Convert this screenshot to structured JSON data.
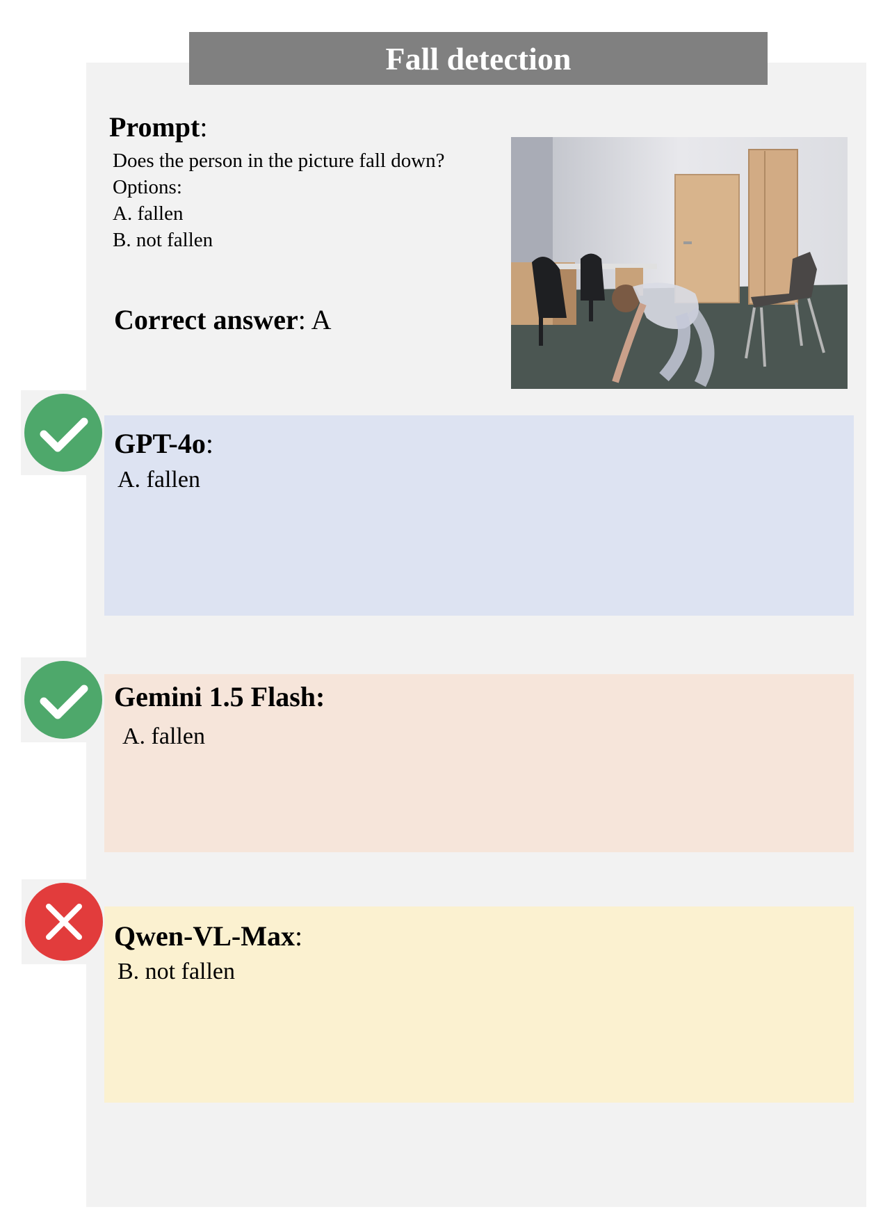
{
  "title": "Fall detection",
  "prompt": {
    "label": "Prompt",
    "colon": ":",
    "question": "Does the person in the picture fall down?",
    "options_label": "Options:",
    "options": [
      "A. fallen",
      "B. not fallen"
    ]
  },
  "correct_answer": {
    "label": "Correct answer",
    "value": ": A"
  },
  "models": [
    {
      "name": "GPT-4o",
      "suffix": ":",
      "answer": "A. fallen",
      "result": "check-icon",
      "color": "#dde3f2"
    },
    {
      "name": "Gemini 1.5 Flash:",
      "suffix": "",
      "answer": "A. fallen",
      "result": "check-icon",
      "color": "#f6e5da"
    },
    {
      "name": "Qwen-VL-Max",
      "suffix": ":",
      "answer": "B. not fallen",
      "result": "cross-icon",
      "color": "#fbf1d0"
    }
  ],
  "colors": {
    "title_bar": "#808080",
    "panel": "#f2f2f2",
    "check_badge": "#4ea86b",
    "cross_badge": "#e23c3c"
  }
}
